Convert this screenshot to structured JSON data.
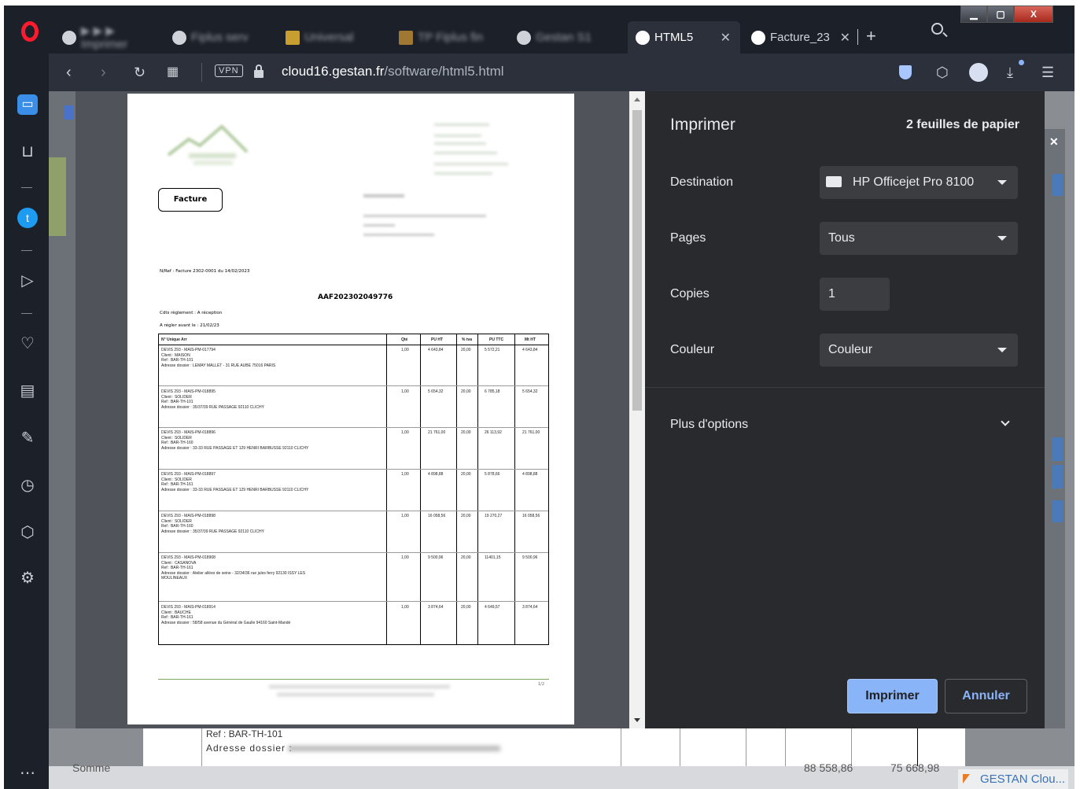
{
  "browser": {
    "tabs": [
      {
        "title": "▶ ▶ ▶ Imprimer",
        "blurred": true
      },
      {
        "title": "Fiplus serv",
        "blurred": true
      },
      {
        "title": "Universal",
        "blurred": true
      },
      {
        "title": "TP Fiplus fin",
        "blurred": true
      },
      {
        "title": "Gestan S1",
        "blurred": true
      },
      {
        "title": "HTML5",
        "active": true
      },
      {
        "title": "Facture_23"
      }
    ],
    "new_tab_label": "+",
    "url_host": "cloud16.gestan.fr",
    "url_path": "/software/html5.html",
    "vpn_label": "VPN",
    "window_controls": {
      "minimize": "▁",
      "maximize": "▢",
      "close": "X"
    }
  },
  "print_dialog": {
    "title": "Imprimer",
    "sheets": "2 feuilles de papier",
    "destination_label": "Destination",
    "destination_value": "HP Officejet Pro 8100",
    "pages_label": "Pages",
    "pages_value": "Tous",
    "copies_label": "Copies",
    "copies_value": "1",
    "color_label": "Couleur",
    "color_value": "Couleur",
    "more_options": "Plus d'options",
    "print_button": "Imprimer",
    "cancel_button": "Annuler"
  },
  "invoice": {
    "doc_type": "Facture",
    "reference": "N/Ref : Facture 2302-0001 du 14/02/2023",
    "number": "AAF202302049776",
    "payment_cond": "Cdts règlement : A réception",
    "due_date": "A régler avant le : 21/02/23",
    "footer_page": "1/2",
    "columns": [
      "N° Unique Arr",
      "Qté",
      "PU HT",
      "% tva",
      "PU TTC",
      "Mt HT"
    ],
    "rows": [
      {
        "lines": [
          "DEVIS 293 - MAIS-PM-017794",
          "Client : MAISON",
          "Ref : BAR-TH-101",
          "Adresse dossier : LEMAY MALLET - 31 RUE AUBE 75016 PARIS"
        ],
        "qty": "1,00",
        "pu_ht": "4 643,84",
        "tva": "20,00",
        "pu_ttc": "5 572,21",
        "mt_ht": "4 643,84"
      },
      {
        "lines": [
          "DEVIS 293 - MAIS-PM-018895",
          "Client : SOLIDER",
          "Ref : BAR-TH-101",
          "Adresse dossier : 35/37/39 RUE PASSAGE 92110 CLICHY"
        ],
        "qty": "1,00",
        "pu_ht": "5 654,32",
        "tva": "20,00",
        "pu_ttc": "6 785,18",
        "mt_ht": "5 654,32"
      },
      {
        "lines": [
          "DEVIS 293 - MAIS-PM-018896",
          "Client : SOLIDER",
          "Ref : BAR-TH-160",
          "Adresse dossier : 33-33 RUE PASSAGE ET 129 HENRI BARBUSSE 92110 CLICHY"
        ],
        "qty": "1,00",
        "pu_ht": "21 761,00",
        "tva": "20,00",
        "pu_ttc": "26 113,92",
        "mt_ht": "21 761,00"
      },
      {
        "lines": [
          "DEVIS 293 - MAIS-PM-018897",
          "Client : SOLIDER",
          "Ref : BAR-TH-161",
          "Adresse dossier : 33-33 RUE PASSAGE ET 129 HENRI BARBUSSE 92110 CLICHY"
        ],
        "qty": "1,00",
        "pu_ht": "4 898,88",
        "tva": "20,00",
        "pu_ttc": "5 878,66",
        "mt_ht": "4 898,88"
      },
      {
        "lines": [
          "DEVIS 293 - MAIS-PM-018898",
          "Client : SOLIDER",
          "Ref : BAR-TH-160",
          "Adresse dossier : 35/37/39 RUE PASSAGE 92110 CLICHY"
        ],
        "qty": "1,00",
        "pu_ht": "16 058,56",
        "tva": "20,00",
        "pu_ttc": "19 270,27",
        "mt_ht": "16 058,56"
      },
      {
        "lines": [
          "DEVIS 293 - MAIS-PM-018908",
          "Client : CASANOVA",
          "Ref : BAR-TH-161",
          "Adresse dossier : Atelier allées de seine - 32/34/36 rue jules ferry 92130 ISSY LES",
          "MOULINEAUX"
        ],
        "qty": "1,00",
        "pu_ht": "9 500,96",
        "tva": "20,00",
        "pu_ttc": "11401,15",
        "mt_ht": "9 500,96"
      },
      {
        "lines": [
          "DEVIS 293 - MAIS-PM-018914",
          "Client : BAUCHE",
          "Ref : BAR-TH-161",
          "Adresse dossier : 58/58 avenue du Général de Gaulle 94160 Saint-Mandé"
        ],
        "qty": "1,00",
        "pu_ht": "3 874,64",
        "tva": "20,00",
        "pu_ttc": "4 649,57",
        "mt_ht": "3 874,64"
      }
    ]
  },
  "background_app": {
    "ref_line": "Ref : BAR-TH-101",
    "address_label": "Adresse dossier :",
    "sum_label": "Somme",
    "total_a": "88 558,86",
    "total_b": "75 668,98",
    "footer_brand": "GESTAN Clou..."
  },
  "colors": {
    "opera_red": "#ff1b2d",
    "print_btn": "#8ab4f8",
    "cancel_text": "#8ab4f8",
    "panel_bg": "#292a2d",
    "chrome_dark": "#1c2028"
  }
}
